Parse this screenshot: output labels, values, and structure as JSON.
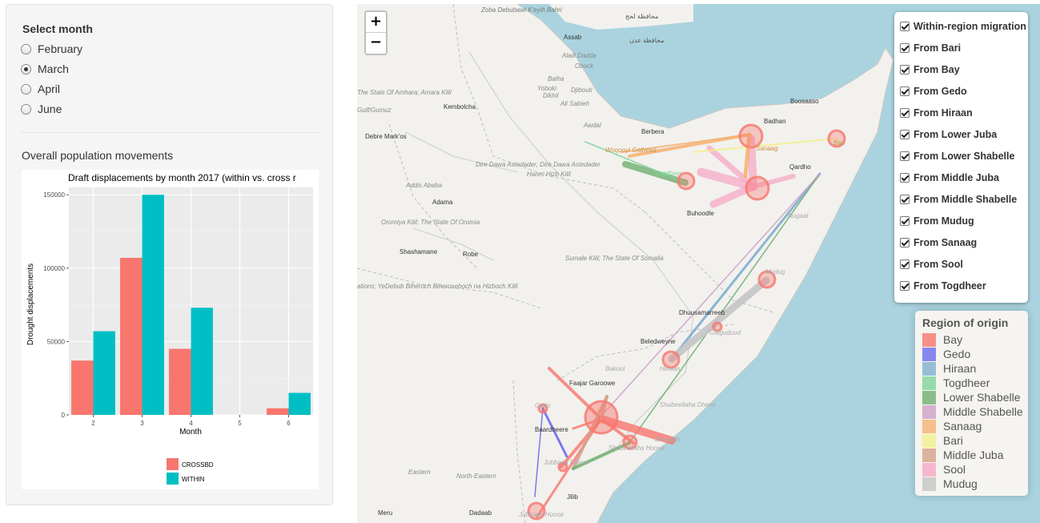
{
  "sidebar": {
    "select_title": "Select month",
    "months": [
      "February",
      "March",
      "April",
      "June"
    ],
    "selected_month": "March",
    "overall_title": "Overall population movements"
  },
  "chart_data": {
    "type": "bar",
    "title": "Draft displacements by month 2017 (within vs. cross r",
    "xlabel": "Month",
    "ylabel": "Drought displacements",
    "categories": [
      "2",
      "3",
      "4",
      "5",
      "6"
    ],
    "ylim": [
      0,
      155000
    ],
    "yticks": [
      0,
      50000,
      100000,
      150000
    ],
    "grid": true,
    "legend_position": "bottom",
    "series": [
      {
        "name": "CROSSBD",
        "color": "#F8766D",
        "values": [
          37000,
          107000,
          45000,
          0,
          4500
        ]
      },
      {
        "name": "WITHIN",
        "color": "#00BFC4",
        "values": [
          57000,
          150000,
          73000,
          0,
          15000
        ]
      }
    ]
  },
  "map": {
    "zoom_in": "+",
    "zoom_out": "−",
    "place_labels": [
      "Zoba Debubawi K'eyih Bahri",
      "Assab",
      "Alaili Dadda",
      "Obock",
      "Balha",
      "Yoboki",
      "Dikhil",
      "Djibouti",
      "Ali Sabieh",
      "Awdal",
      "Berbera",
      "Woqooyi Galbeed",
      "Togdheer",
      "Buhoodle",
      "Badhan",
      "Sanaag",
      "Boosaaso",
      "Bari",
      "Qardho",
      "Nugaal",
      "Mudug",
      "Dhuusamarreeb",
      "Galguduud",
      "Beledweyne",
      "Hiiraan",
      "Bakool",
      "Faajar Garoowe",
      "Shabeellaha Dhexe",
      "Banaadir",
      "Gedo",
      "Baardheere",
      "Jubbada Dhexe",
      "Shabeellaha Hoose",
      "Jilib",
      "Jubbada Hoose",
      "Dadaab",
      "Eastern",
      "North-Eastern",
      "Meru",
      "The State Of Amhara; Amara Kilil",
      "Kembolcha",
      "Gulf/Gumuz",
      "Debre Mark'os",
      "Dire Dawa Astedader; Dire Dawa Astedader",
      "Hareri Hizb Kilil",
      "Addis Abeba",
      "Adama",
      "Oromiya Kilil; The State Of Oromia",
      "Shashamane",
      "Robe",
      "Sumale Kilil; The State Of Somalia",
      "ations; YeDebub Biheroch Biheroseboch na Hizboch Kilil",
      "محافظة لحج",
      "محافظة عدن"
    ]
  },
  "layers": {
    "items": [
      "Within-region migration",
      "From Bari",
      "From Bay",
      "From Gedo",
      "From Hiraan",
      "From Lower Juba",
      "From Lower Shabelle",
      "From Middle Juba",
      "From Middle Shabelle",
      "From Mudug",
      "From Sanaag",
      "From Sool",
      "From Togdheer"
    ]
  },
  "legend": {
    "title": "Region of origin",
    "items": [
      {
        "label": "Bay",
        "color": "#F8766D"
      },
      {
        "label": "Gedo",
        "color": "#6B6BF0"
      },
      {
        "label": "Hiraan",
        "color": "#7FAECF"
      },
      {
        "label": "Togdheer",
        "color": "#7ED39A"
      },
      {
        "label": "Lower Shabelle",
        "color": "#6FAF6F"
      },
      {
        "label": "Middle Shabelle",
        "color": "#CFA0C8"
      },
      {
        "label": "Sanaag",
        "color": "#F6B070"
      },
      {
        "label": "Bari",
        "color": "#F4F08C"
      },
      {
        "label": "Middle Juba",
        "color": "#D7A08A"
      },
      {
        "label": "Sool",
        "color": "#F6A8C6"
      },
      {
        "label": "Mudug",
        "color": "#C4C4C4"
      }
    ]
  }
}
